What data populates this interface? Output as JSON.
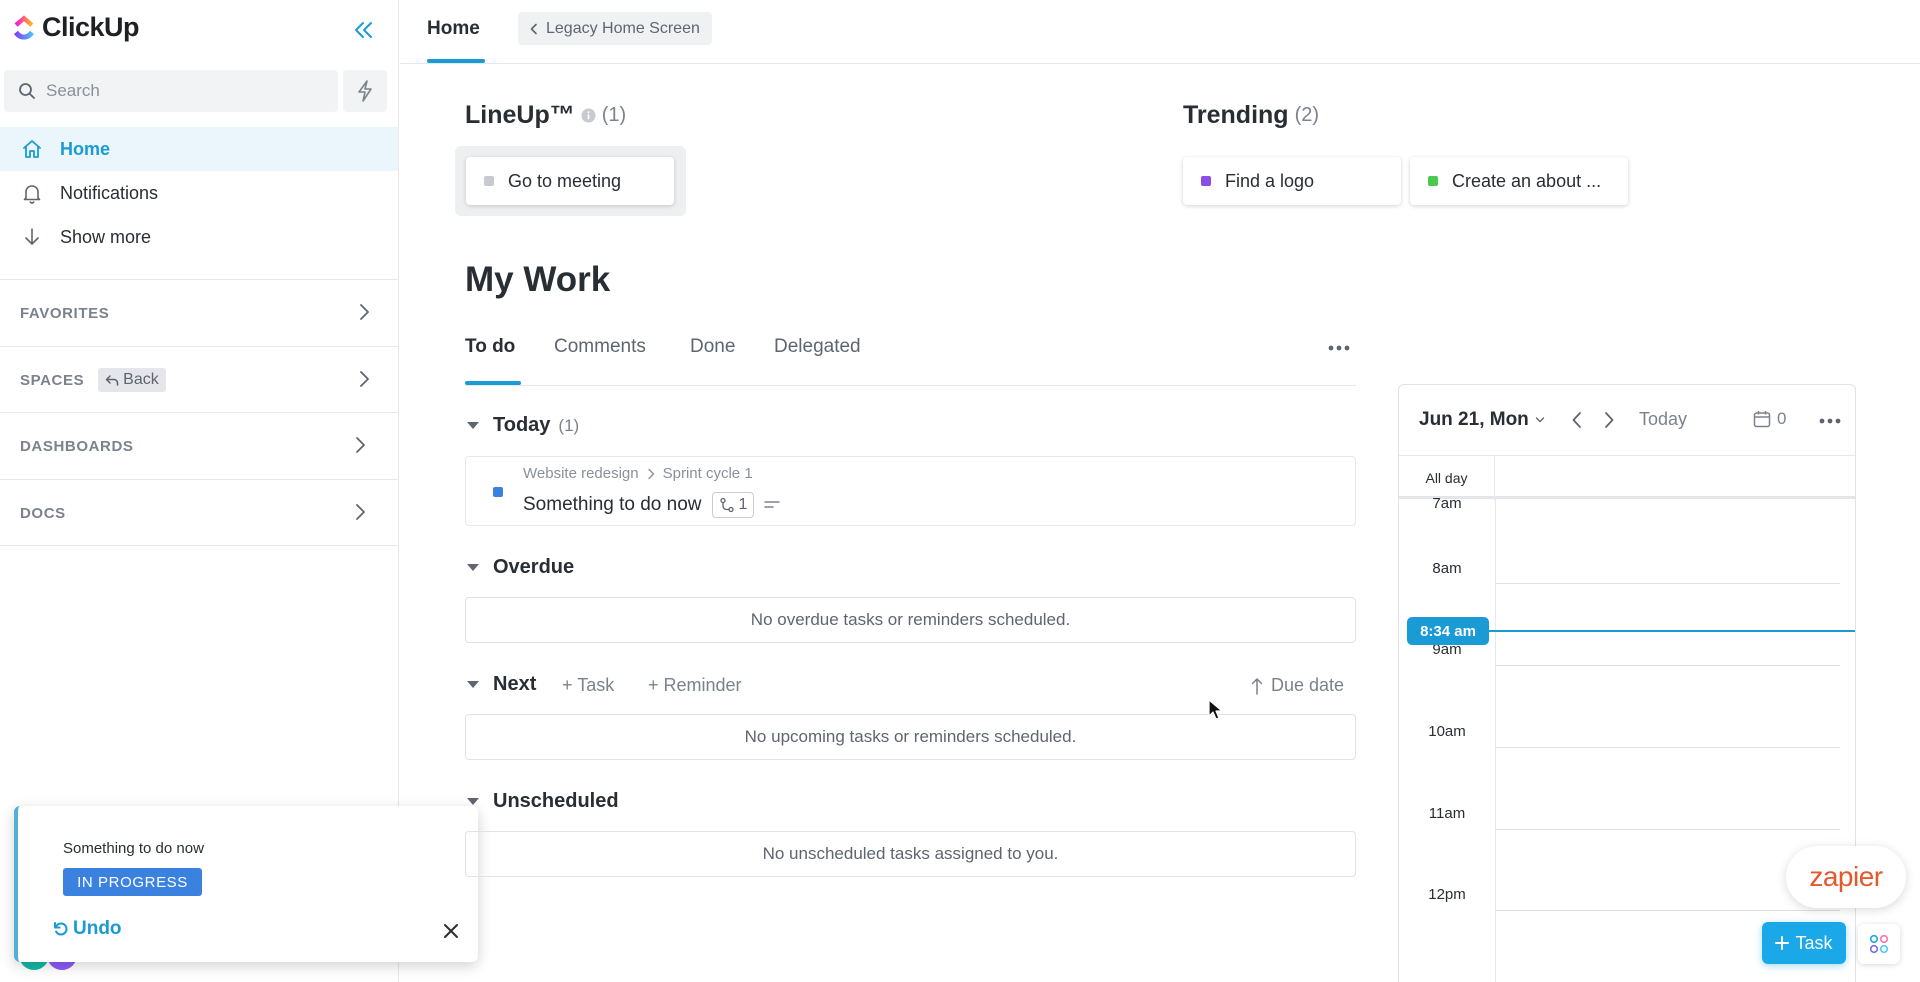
{
  "brand": {
    "name": "ClickUp"
  },
  "sidebar": {
    "search_placeholder": "Search",
    "nav": [
      {
        "label": "Home",
        "icon": "home-icon"
      },
      {
        "label": "Notifications",
        "icon": "bell-icon"
      },
      {
        "label": "Show more",
        "icon": "arrow-down-icon"
      }
    ],
    "sections": [
      {
        "label": "FAVORITES"
      },
      {
        "label": "SPACES",
        "chip": "Back"
      },
      {
        "label": "DASHBOARDS"
      },
      {
        "label": "DOCS"
      }
    ]
  },
  "toast": {
    "title": "Something to do now",
    "status": "IN PROGRESS",
    "undo": "Undo"
  },
  "header": {
    "tab": "Home",
    "legacy": "Legacy Home Screen"
  },
  "lineup": {
    "title": "LineUp™",
    "count": "(1)",
    "items": [
      {
        "label": "Go to meeting",
        "color": "#c8cacf"
      }
    ]
  },
  "trending": {
    "title": "Trending",
    "count": "(2)",
    "items": [
      {
        "label": "Find a logo",
        "color": "#8b4fe6"
      },
      {
        "label": "Create an about ...",
        "color": "#4cc94c"
      }
    ]
  },
  "my_work": {
    "title": "My Work",
    "tabs": [
      "To do",
      "Comments",
      "Done",
      "Delegated"
    ],
    "groups": {
      "today": {
        "label": "Today",
        "count": "(1)"
      },
      "overdue": {
        "label": "Overdue",
        "empty": "No overdue tasks or reminders scheduled."
      },
      "next": {
        "label": "Next",
        "add_task": "+ Task",
        "add_reminder": "+ Reminder",
        "sort": "Due date",
        "empty": "No upcoming tasks or reminders scheduled."
      },
      "unscheduled": {
        "label": "Unscheduled",
        "empty": "No unscheduled tasks assigned to you."
      }
    },
    "task": {
      "list": "Website redesign",
      "sprint": "Sprint cycle 1",
      "name": "Something to do now",
      "subtasks": "1",
      "color": "#3b82e0"
    }
  },
  "calendar": {
    "date": "Jun 21, Mon",
    "today": "Today",
    "count": "0",
    "all_day": "All day",
    "now": "8:34 am",
    "hours": [
      "7am",
      "8am",
      "9am",
      "10am",
      "11am",
      "12pm"
    ]
  },
  "floating": {
    "zapier": "zapier",
    "task_button": "Task"
  },
  "colors": {
    "accent": "#1a9bd6",
    "status_in_progress": "#3b82e0"
  }
}
